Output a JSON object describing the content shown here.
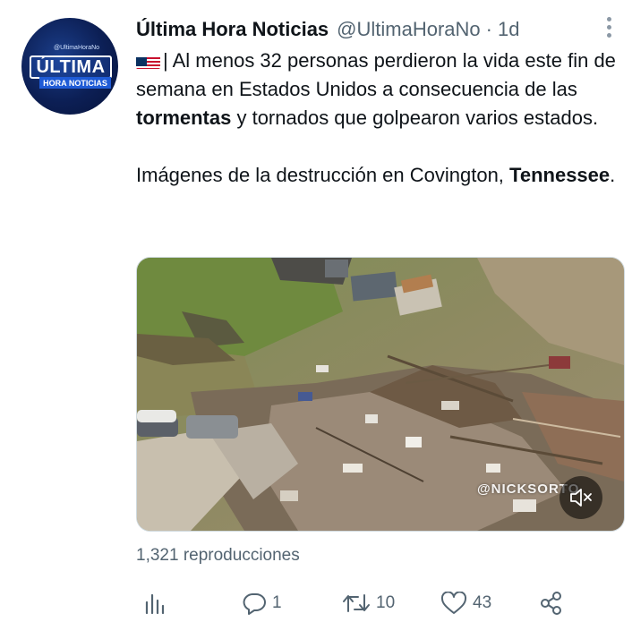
{
  "account": {
    "display_name": "Última Hora Noticias",
    "handle": "@UltimaHoraNo",
    "timestamp": "1d",
    "avatar": {
      "handle_small": "@UltimaHoraNo",
      "brand_main": "ÚLTIMA",
      "brand_sub": "HORA NOTICIAS"
    }
  },
  "tweet": {
    "flag_icon": "us-flag-icon",
    "para1_a": "| Al menos 32 personas perdieron la vida este fin de semana en Estados Unidos a consecuencia de las ",
    "para1_bold": "tormentas",
    "para1_b": " y tornados que golpearon varios estados.",
    "para2_a": "Imágenes de la destrucción en Covington, ",
    "para2_bold": "Tennessee",
    "para2_b": "."
  },
  "media": {
    "watermark": "@NICKSORTO",
    "mute_icon": "volume-muted-icon"
  },
  "views": "1,321 reproducciones",
  "actions": {
    "analytics_icon": "analytics-icon",
    "reply_count": "1",
    "retweet_count": "10",
    "like_count": "43",
    "share_icon": "share-icon"
  },
  "colors": {
    "text": "#0f1419",
    "secondary": "#536471",
    "avatar_bg": "#0c1f55"
  }
}
